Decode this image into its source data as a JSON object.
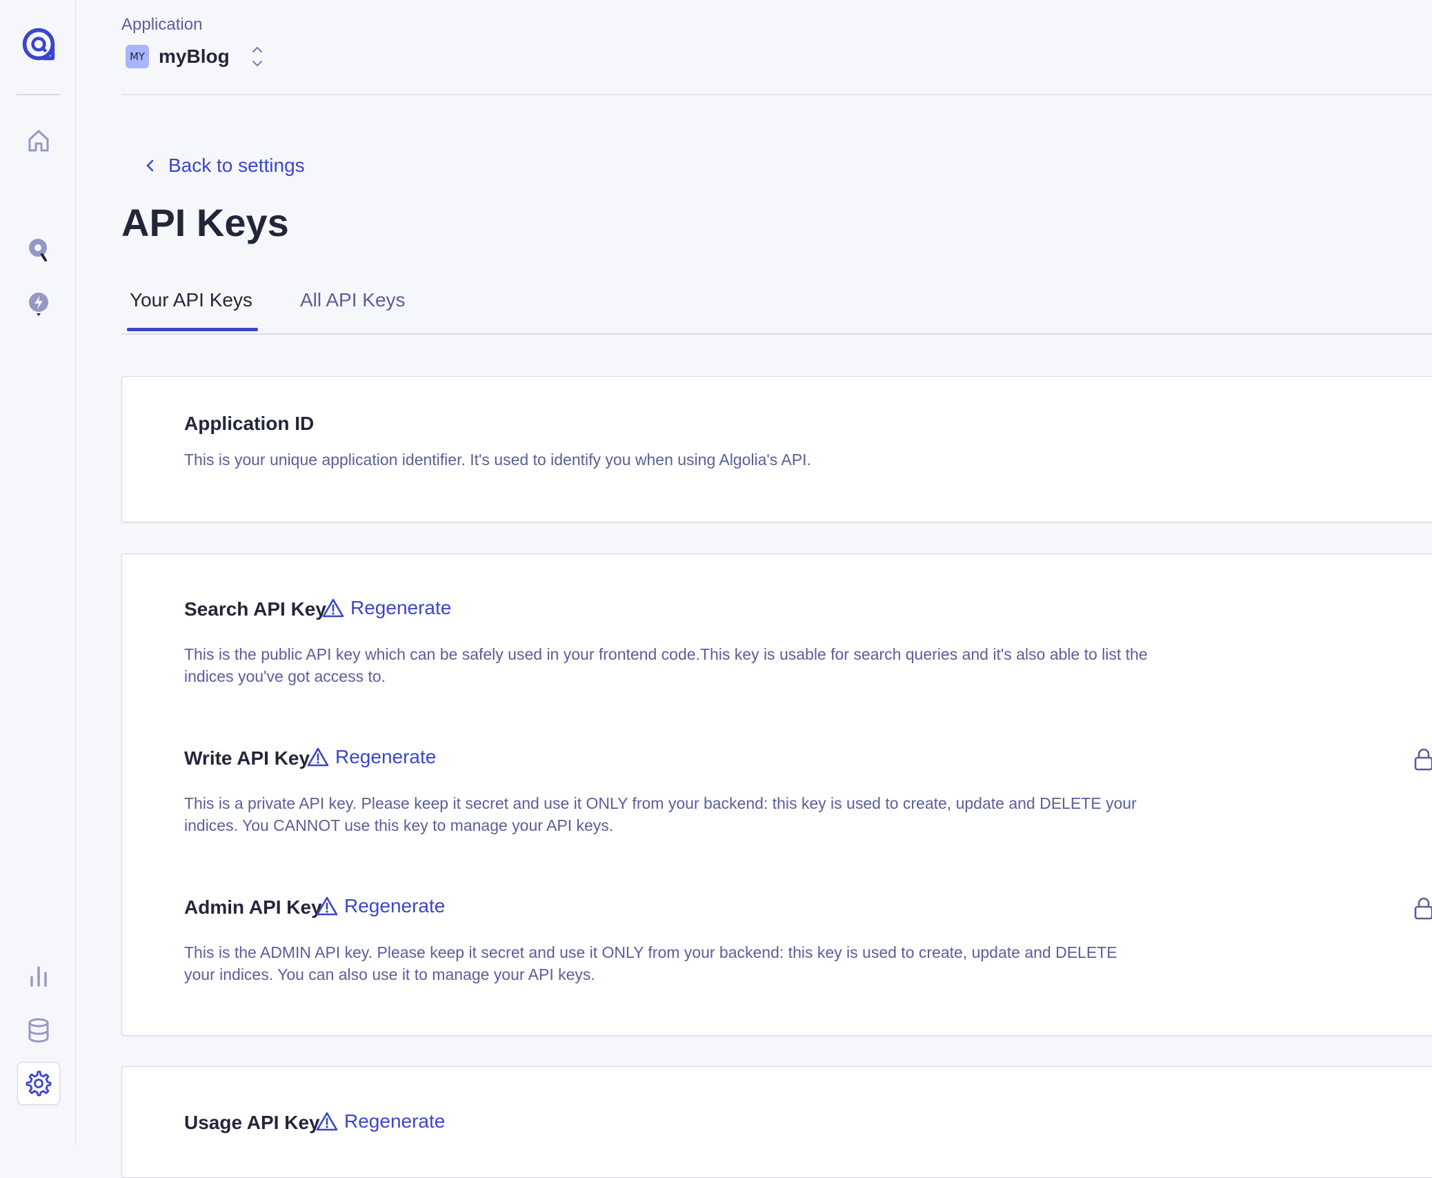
{
  "colors": {
    "accent": "#3a46cc",
    "text": "#23263b",
    "muted": "#5a5e9a",
    "badge": "#a9b4f9"
  },
  "sidebar": {
    "logo_icon": "algolia-logo-icon",
    "items": [
      {
        "name": "home",
        "icon": "home-icon"
      },
      {
        "name": "search",
        "icon": "search-pin-icon"
      },
      {
        "name": "recommend",
        "icon": "bolt-pin-icon"
      },
      {
        "name": "analytics",
        "icon": "bar-chart-icon"
      },
      {
        "name": "data-sources",
        "icon": "database-icon"
      },
      {
        "name": "settings",
        "icon": "gear-icon",
        "active": true
      }
    ]
  },
  "header": {
    "label": "Application",
    "app_badge": "MY",
    "app_name": "myBlog"
  },
  "page": {
    "back_label": "Back to settings",
    "title": "API Keys",
    "tabs": [
      {
        "label": "Your API Keys",
        "active": true
      },
      {
        "label": "All API Keys",
        "active": false
      }
    ]
  },
  "keys": {
    "regenerate_label": "Regenerate",
    "application_id": {
      "title": "Application ID",
      "description": "This is your unique application identifier. It's used to identify you when using Algolia's API."
    },
    "search": {
      "title": "Search API Key",
      "description": "This is the public API key which can be safely used in your frontend code.This key is usable for search queries and it's also able to list the indices you've got access to."
    },
    "write": {
      "title": "Write API Key",
      "description": "This is a private API key. Please keep it secret and use it ONLY from your backend: this key is used to create, update and DELETE your indices. You CANNOT use this key to manage your API keys."
    },
    "admin": {
      "title": "Admin API Key",
      "description": "This is the ADMIN API key. Please keep it secret and use it ONLY from your backend: this key is used to create, update and DELETE your indices. You can also use it to manage your API keys."
    },
    "usage": {
      "title": "Usage API Key"
    }
  }
}
